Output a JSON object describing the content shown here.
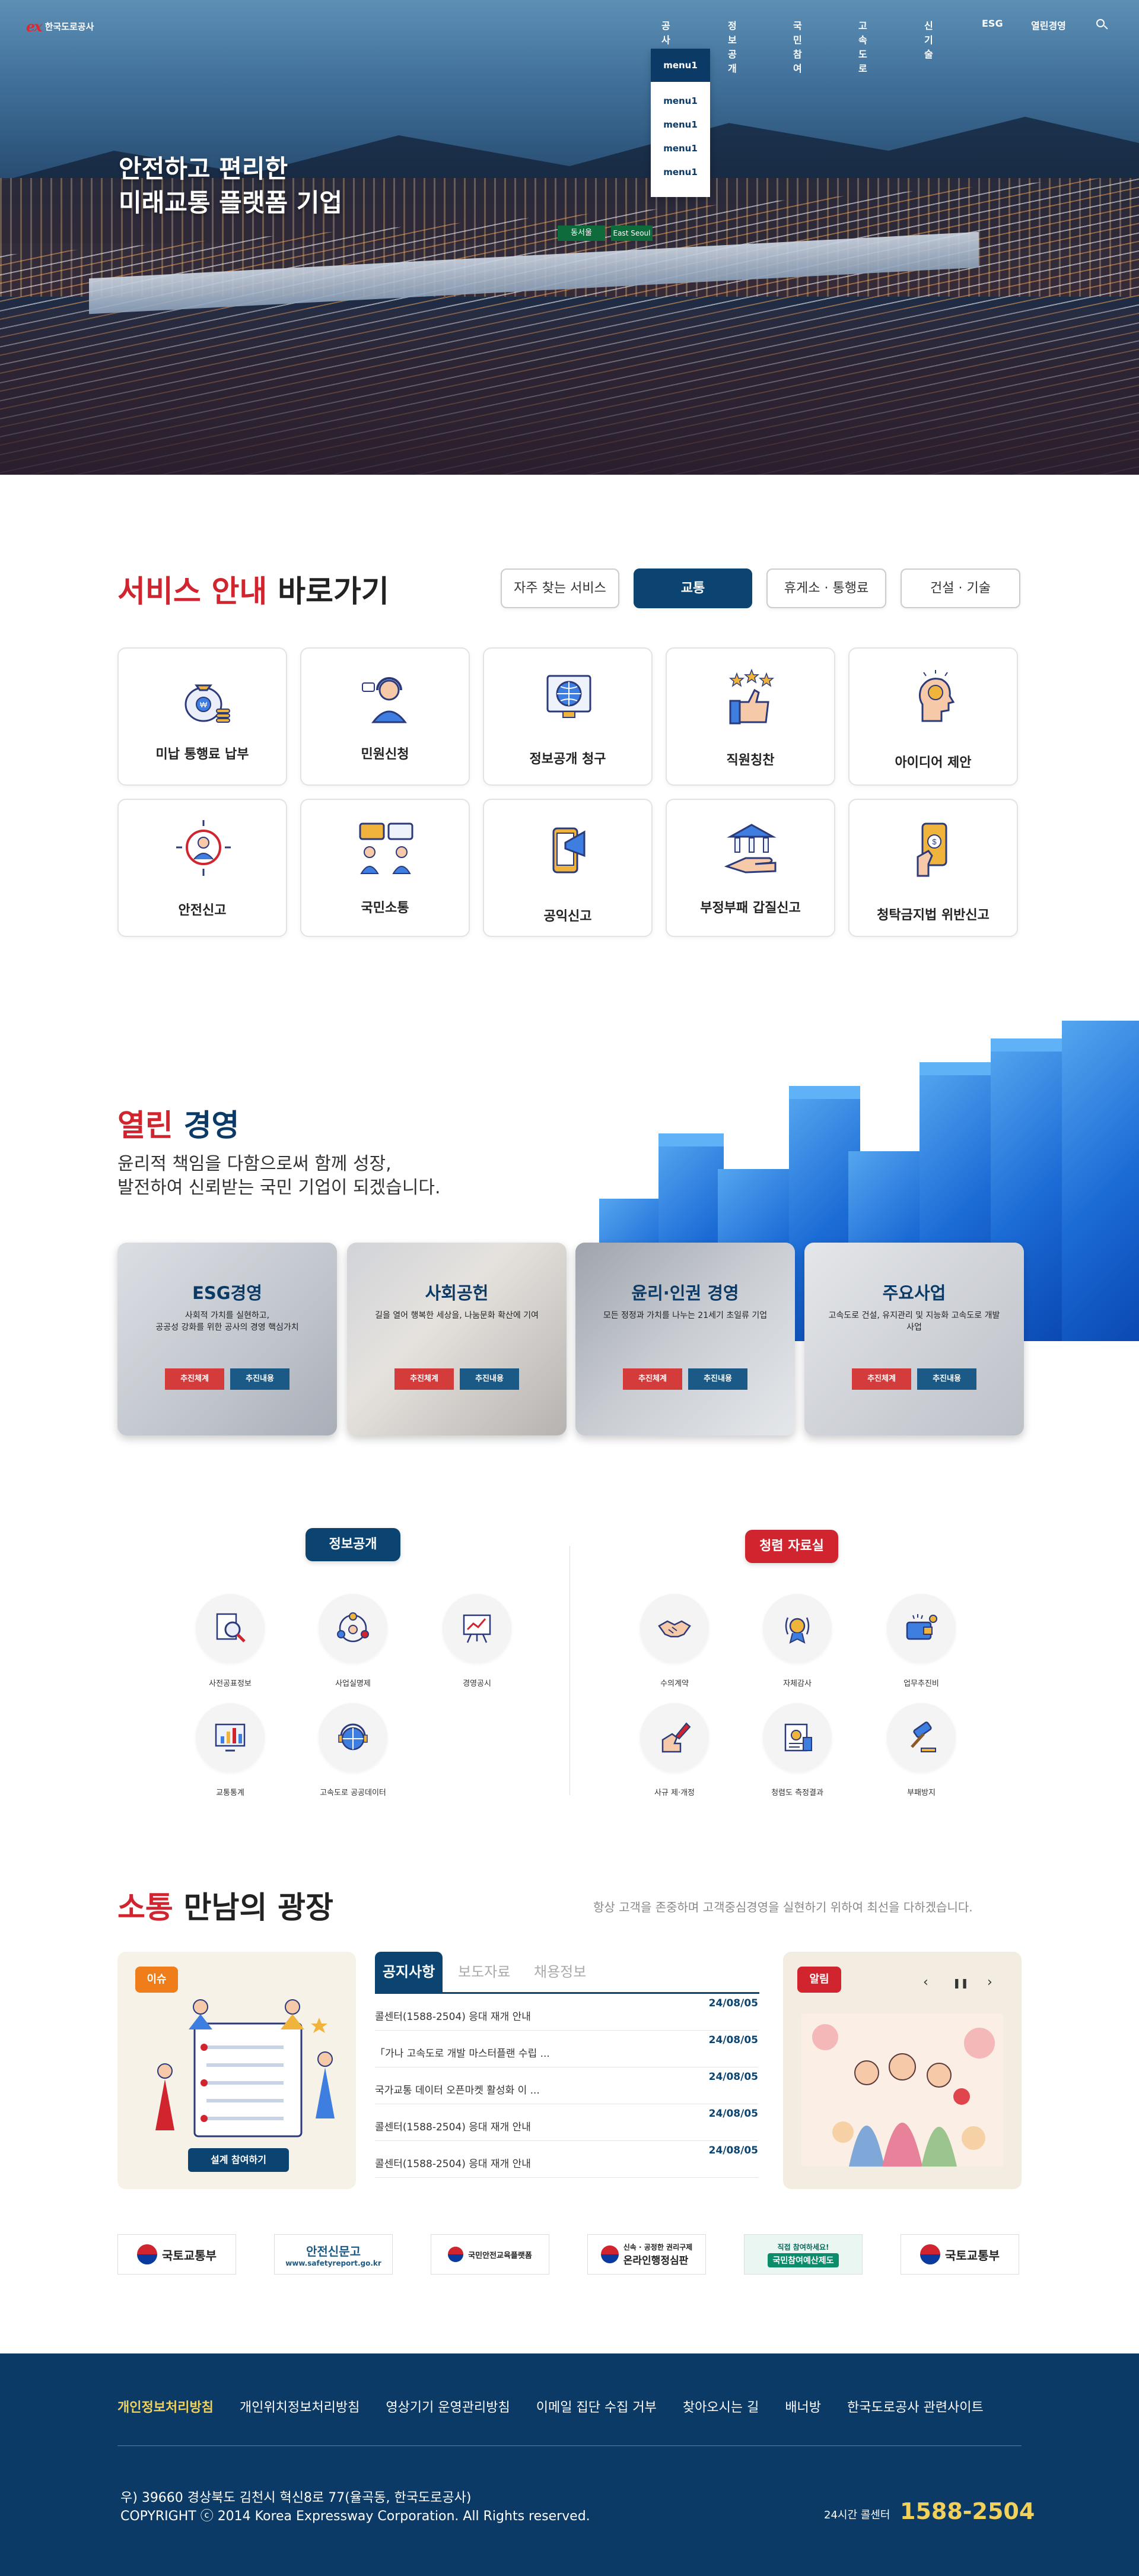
{
  "header": {
    "logo_mark": "ex",
    "logo_name": "한국도로공사",
    "nav": [
      "공사소개",
      "정보공개",
      "국민참여",
      "고속도로",
      "신기술",
      "ESG",
      "열린경영"
    ],
    "dropdown": {
      "active": "menu1",
      "items": [
        "menu1",
        "menu1",
        "menu1",
        "menu1"
      ]
    }
  },
  "hero": {
    "title_line1": "안전하고 편리한",
    "title_line2": "미래교통 플랫폼 기업",
    "sign1": "동서울",
    "sign2": "East Seoul"
  },
  "service": {
    "title_red": "서비스 안내",
    "title_rest": "바로가기",
    "tabs": [
      "자주 찾는 서비스",
      "교통",
      "휴게소 · 통행료",
      "건설 · 기술"
    ],
    "cards": [
      "미납 통행료 납부",
      "민원신청",
      "정보공개 청구",
      "직원칭찬",
      "아이디어 제안",
      "안전신고",
      "국민소통",
      "공익신고",
      "부정부패 갑질신고",
      "청탁금지법 위반신고"
    ]
  },
  "open": {
    "title_red": "열린",
    "title_rest": "경영",
    "desc_line1": "윤리적 책임을 다함으로써 함께 성장,",
    "desc_line2": "발전하여 신뢰받는 국민 기업이 되겠습니다.",
    "cards": [
      {
        "title": "ESG경영",
        "text": "사회적 가치를 실현하고,\n공공성 강화를 위한 공사의 경영 핵심가치",
        "btn1": "추진체계",
        "btn2": "추진내용"
      },
      {
        "title": "사회공헌",
        "text": "길을 열어 행복한 세상을, 나눔문화 확산에 기여",
        "btn1": "추진체계",
        "btn2": "추진내용"
      },
      {
        "title": "윤리·인권 경영",
        "text": "모든 정정과 가치를 나누는 21세기 초일류 기업",
        "btn1": "추진체계",
        "btn2": "추진내용"
      },
      {
        "title": "주요사업",
        "text": "고속도로 건설, 유지관리 및 지능화 고속도로 개발사업",
        "btn1": "추진체계",
        "btn2": "추진내용"
      }
    ]
  },
  "info": {
    "left_pill": "정보공개",
    "right_pill": "청렴 자료실",
    "left_items": [
      "사전공표정보",
      "사업실명제",
      "경영공시",
      "교통통계",
      "고속도로 공공데이터"
    ],
    "right_items": [
      "수의계약",
      "자체감사",
      "업무추진비",
      "사규 제·개정",
      "청렴도 측정결과",
      "부패방지"
    ]
  },
  "sotong": {
    "title_red": "소통",
    "title_rest": "만남의 광장",
    "desc": "항상 고객을 존중하며 고객중심경영을 실현하기 위하여 최선을 다하겠습니다.",
    "issue_tag": "이슈",
    "issue_btn": "설계 참여하기",
    "notice_tabs": [
      "공지사항",
      "보도자료",
      "채용정보"
    ],
    "notices": [
      {
        "title": "콜센터(1588-2504) 응대 재개 안내",
        "date": "24/08/05"
      },
      {
        "title": "「가나 고속도로 개발 마스터플랜 수립 ...",
        "date": "24/08/05"
      },
      {
        "title": "국가교통 데이터 오픈마켓 활성화 이 ...",
        "date": "24/08/05"
      },
      {
        "title": "콜센터(1588-2504) 응대 재개 안내",
        "date": "24/08/05"
      },
      {
        "title": "콜센터(1588-2504) 응대 재개 안내",
        "date": "24/08/05"
      }
    ],
    "alarm_tag": "알림",
    "alarm_prev": "‹",
    "alarm_pause": "❚❚",
    "alarm_next": "›"
  },
  "banners": [
    {
      "text": "국토교통부"
    },
    {
      "text": "안전신문고",
      "sub": "www.safetyreport.go.kr"
    },
    {
      "text": "국민안전교육플랫폼"
    },
    {
      "text": "온라인행정심판",
      "sub": "신속 · 공정한 권리구제"
    },
    {
      "text": "국민참여예산제도",
      "sub": "직접 참여하세요!"
    },
    {
      "text": "국토교통부"
    }
  ],
  "footer": {
    "links": [
      "개인정보처리방침",
      "개인위치정보처리방침",
      "영상기기 운영관리방침",
      "이메일 집단 수집 거부",
      "찾아오시는 길",
      "배너방",
      "한국도로공사 관련사이트"
    ],
    "address": "우) 39660 경상북도 김천시 혁신8로 77(율곡동, 한국도로공사)",
    "copyright": "COPYRIGHT ⓒ 2014 Korea Expressway Corporation. All Rights reserved.",
    "call_label": "24시간 콜센터",
    "call_number": "1588-2504"
  },
  "colors": {
    "navy": "#0b4470",
    "red": "#d0252f",
    "orange": "#ef7d1a",
    "gold": "#f2d15a"
  }
}
